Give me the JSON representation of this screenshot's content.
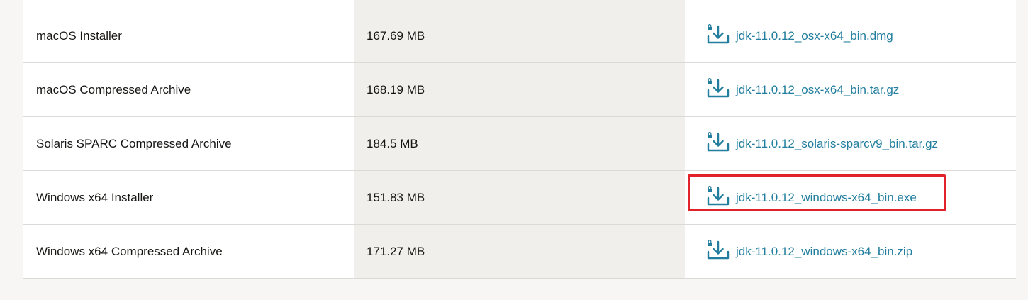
{
  "colors": {
    "link": "#227e9e",
    "highlight": "#e0222a",
    "size_column_bg": "#f0efec"
  },
  "rows": [
    {
      "product": "macOS Installer",
      "size": "167.69 MB",
      "file": "jdk-11.0.12_osx-x64_bin.dmg",
      "icon": "lock-download-icon"
    },
    {
      "product": "macOS Compressed Archive",
      "size": "168.19 MB",
      "file": "jdk-11.0.12_osx-x64_bin.tar.gz",
      "icon": "lock-download-icon"
    },
    {
      "product": "Solaris SPARC Compressed Archive",
      "size": "184.5 MB",
      "file": "jdk-11.0.12_solaris-sparcv9_bin.tar.gz",
      "icon": "lock-download-icon"
    },
    {
      "product": "Windows x64 Installer",
      "size": "151.83 MB",
      "file": "jdk-11.0.12_windows-x64_bin.exe",
      "icon": "lock-download-icon",
      "highlighted": true
    },
    {
      "product": "Windows x64 Compressed Archive",
      "size": "171.27 MB",
      "file": "jdk-11.0.12_windows-x64_bin.zip",
      "icon": "lock-download-icon"
    }
  ]
}
